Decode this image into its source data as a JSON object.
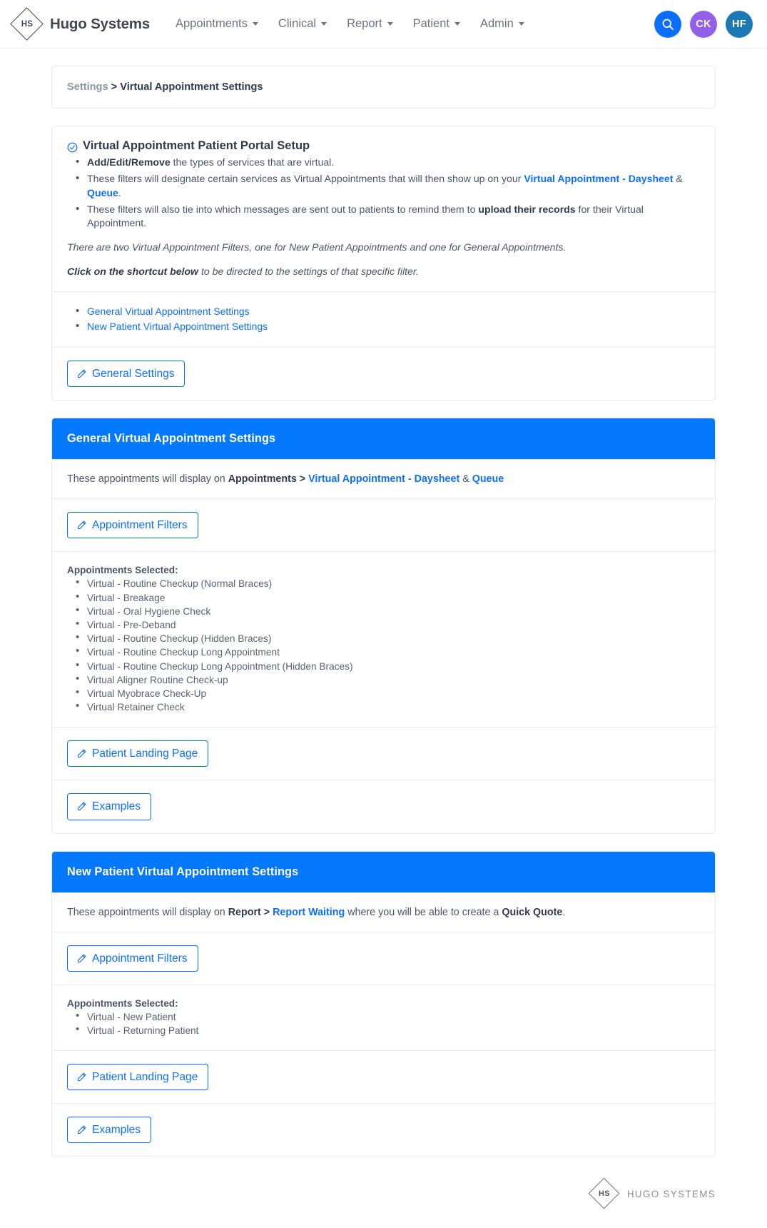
{
  "navbar": {
    "logo_letters": "HS",
    "brand": "Hugo Systems",
    "links": [
      {
        "label": "Appointments"
      },
      {
        "label": "Clinical"
      },
      {
        "label": "Report"
      },
      {
        "label": "Patient"
      },
      {
        "label": "Admin"
      }
    ],
    "search_icon": "search-icon",
    "avatars": [
      {
        "initials": "CK",
        "color": "#9261e8"
      },
      {
        "initials": "HF",
        "color": "#1b79b5"
      }
    ]
  },
  "breadcrumb": {
    "parent": "Settings",
    "separator": " > ",
    "current": "Virtual Appointment Settings"
  },
  "info_panel": {
    "title": "Virtual Appointment Patient Portal Setup",
    "title_icon": "check-circle-icon",
    "bullet1_strong": "Add/Edit/Remove",
    "bullet1_rest": " the types of services that are virtual.",
    "bullet2_pre": "These filters will designate certain services as Virtual Appointments that will then show up on your ",
    "bullet2_link1": "Virtual Appointment - Daysheet",
    "bullet2_amp": " & ",
    "bullet2_link2": "Queue",
    "bullet2_end": ".",
    "bullet3_pre": "These filters will also tie into which messages are sent out to patients to remind them to ",
    "bullet3_strong": "upload their records",
    "bullet3_end": " for their Virtual Appointment.",
    "note1": "There are two Virtual Appointment Filters, one for New Patient Appointments and one for General Appointments.",
    "note2_strong": "Click on the shortcut below",
    "note2_rest": " to be directed to the settings of that specific filter.",
    "shortcuts": [
      "General Virtual Appointment Settings",
      "New Patient Virtual Appointment Settings"
    ],
    "general_settings_button": "General Settings"
  },
  "general_section": {
    "header": "General Virtual Appointment Settings",
    "desc_pre": "These appointments will display on ",
    "desc_bold": "Appointments > ",
    "desc_link1": "Virtual Appointment - Daysheet",
    "desc_amp": " & ",
    "desc_link2": "Queue",
    "filters_button": "Appointment Filters",
    "selected_label": "Appointments Selected:",
    "appointments": [
      "Virtual - Routine Checkup (Normal Braces)",
      "Virtual - Breakage",
      "Virtual - Oral Hygiene Check",
      "Virtual - Pre-Deband",
      "Virtual - Routine Checkup (Hidden Braces)",
      "Virtual - Routine Checkup Long Appointment",
      "Virtual - Routine Checkup Long Appointment (Hidden Braces)",
      "Virtual Aligner Routine Check-up",
      "Virtual Myobrace Check-Up",
      "Virtual Retainer Check"
    ],
    "landing_button": "Patient Landing Page",
    "examples_button": "Examples"
  },
  "new_patient_section": {
    "header": "New Patient Virtual Appointment Settings",
    "desc_pre": "These appointments will display on ",
    "desc_bold": "Report > ",
    "desc_link": "Report Waiting",
    "desc_mid": " where you will be able to create a ",
    "desc_bold2": "Quick Quote",
    "desc_end": ".",
    "filters_button": "Appointment Filters",
    "selected_label": "Appointments Selected:",
    "appointments": [
      "Virtual - New Patient",
      "Virtual - Returning Patient"
    ],
    "landing_button": "Patient Landing Page",
    "examples_button": "Examples"
  },
  "footer": {
    "logo_letters": "HS",
    "name": "HUGO SYSTEMS"
  },
  "colors": {
    "accent_blue": "#0579fc",
    "link_blue": "#0d6efd",
    "avatar_purple": "#9261e8",
    "avatar_teal": "#1b79b5"
  }
}
